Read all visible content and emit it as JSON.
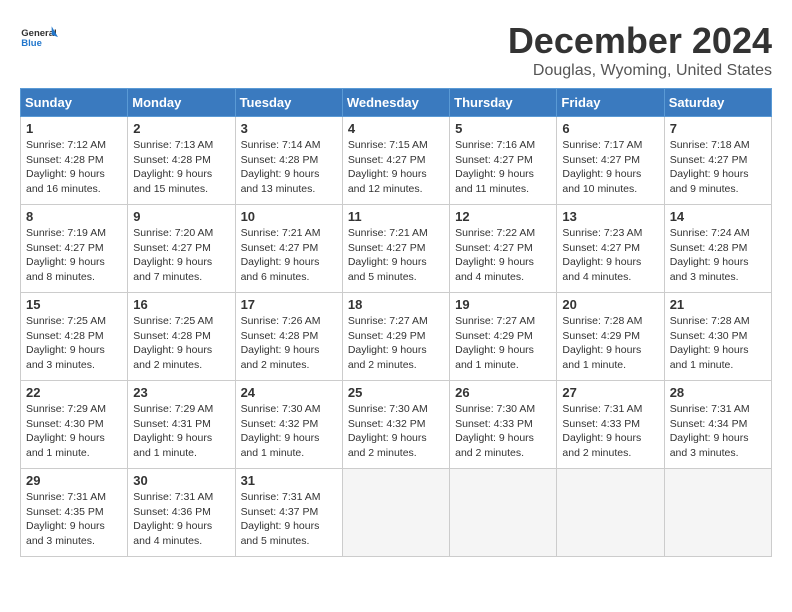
{
  "header": {
    "logo_line1": "General",
    "logo_line2": "Blue",
    "month": "December 2024",
    "location": "Douglas, Wyoming, United States"
  },
  "weekdays": [
    "Sunday",
    "Monday",
    "Tuesday",
    "Wednesday",
    "Thursday",
    "Friday",
    "Saturday"
  ],
  "weeks": [
    [
      {
        "day": "1",
        "info": "Sunrise: 7:12 AM\nSunset: 4:28 PM\nDaylight: 9 hours and 16 minutes."
      },
      {
        "day": "2",
        "info": "Sunrise: 7:13 AM\nSunset: 4:28 PM\nDaylight: 9 hours and 15 minutes."
      },
      {
        "day": "3",
        "info": "Sunrise: 7:14 AM\nSunset: 4:28 PM\nDaylight: 9 hours and 13 minutes."
      },
      {
        "day": "4",
        "info": "Sunrise: 7:15 AM\nSunset: 4:27 PM\nDaylight: 9 hours and 12 minutes."
      },
      {
        "day": "5",
        "info": "Sunrise: 7:16 AM\nSunset: 4:27 PM\nDaylight: 9 hours and 11 minutes."
      },
      {
        "day": "6",
        "info": "Sunrise: 7:17 AM\nSunset: 4:27 PM\nDaylight: 9 hours and 10 minutes."
      },
      {
        "day": "7",
        "info": "Sunrise: 7:18 AM\nSunset: 4:27 PM\nDaylight: 9 hours and 9 minutes."
      }
    ],
    [
      {
        "day": "8",
        "info": "Sunrise: 7:19 AM\nSunset: 4:27 PM\nDaylight: 9 hours and 8 minutes."
      },
      {
        "day": "9",
        "info": "Sunrise: 7:20 AM\nSunset: 4:27 PM\nDaylight: 9 hours and 7 minutes."
      },
      {
        "day": "10",
        "info": "Sunrise: 7:21 AM\nSunset: 4:27 PM\nDaylight: 9 hours and 6 minutes."
      },
      {
        "day": "11",
        "info": "Sunrise: 7:21 AM\nSunset: 4:27 PM\nDaylight: 9 hours and 5 minutes."
      },
      {
        "day": "12",
        "info": "Sunrise: 7:22 AM\nSunset: 4:27 PM\nDaylight: 9 hours and 4 minutes."
      },
      {
        "day": "13",
        "info": "Sunrise: 7:23 AM\nSunset: 4:27 PM\nDaylight: 9 hours and 4 minutes."
      },
      {
        "day": "14",
        "info": "Sunrise: 7:24 AM\nSunset: 4:28 PM\nDaylight: 9 hours and 3 minutes."
      }
    ],
    [
      {
        "day": "15",
        "info": "Sunrise: 7:25 AM\nSunset: 4:28 PM\nDaylight: 9 hours and 3 minutes."
      },
      {
        "day": "16",
        "info": "Sunrise: 7:25 AM\nSunset: 4:28 PM\nDaylight: 9 hours and 2 minutes."
      },
      {
        "day": "17",
        "info": "Sunrise: 7:26 AM\nSunset: 4:28 PM\nDaylight: 9 hours and 2 minutes."
      },
      {
        "day": "18",
        "info": "Sunrise: 7:27 AM\nSunset: 4:29 PM\nDaylight: 9 hours and 2 minutes."
      },
      {
        "day": "19",
        "info": "Sunrise: 7:27 AM\nSunset: 4:29 PM\nDaylight: 9 hours and 1 minute."
      },
      {
        "day": "20",
        "info": "Sunrise: 7:28 AM\nSunset: 4:29 PM\nDaylight: 9 hours and 1 minute."
      },
      {
        "day": "21",
        "info": "Sunrise: 7:28 AM\nSunset: 4:30 PM\nDaylight: 9 hours and 1 minute."
      }
    ],
    [
      {
        "day": "22",
        "info": "Sunrise: 7:29 AM\nSunset: 4:30 PM\nDaylight: 9 hours and 1 minute."
      },
      {
        "day": "23",
        "info": "Sunrise: 7:29 AM\nSunset: 4:31 PM\nDaylight: 9 hours and 1 minute."
      },
      {
        "day": "24",
        "info": "Sunrise: 7:30 AM\nSunset: 4:32 PM\nDaylight: 9 hours and 1 minute."
      },
      {
        "day": "25",
        "info": "Sunrise: 7:30 AM\nSunset: 4:32 PM\nDaylight: 9 hours and 2 minutes."
      },
      {
        "day": "26",
        "info": "Sunrise: 7:30 AM\nSunset: 4:33 PM\nDaylight: 9 hours and 2 minutes."
      },
      {
        "day": "27",
        "info": "Sunrise: 7:31 AM\nSunset: 4:33 PM\nDaylight: 9 hours and 2 minutes."
      },
      {
        "day": "28",
        "info": "Sunrise: 7:31 AM\nSunset: 4:34 PM\nDaylight: 9 hours and 3 minutes."
      }
    ],
    [
      {
        "day": "29",
        "info": "Sunrise: 7:31 AM\nSunset: 4:35 PM\nDaylight: 9 hours and 3 minutes."
      },
      {
        "day": "30",
        "info": "Sunrise: 7:31 AM\nSunset: 4:36 PM\nDaylight: 9 hours and 4 minutes."
      },
      {
        "day": "31",
        "info": "Sunrise: 7:31 AM\nSunset: 4:37 PM\nDaylight: 9 hours and 5 minutes."
      },
      null,
      null,
      null,
      null
    ]
  ]
}
